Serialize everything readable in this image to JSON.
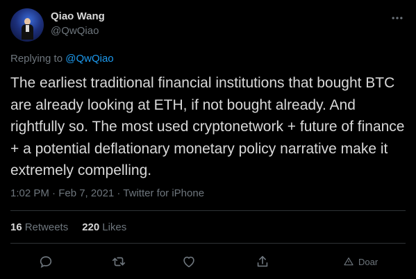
{
  "author": {
    "name": "Qiao Wang",
    "handle": "@QwQiao"
  },
  "reply": {
    "prefix": "Replying to ",
    "mention": "@QwQiao"
  },
  "tweet": {
    "text": "The earliest traditional financial institutions that bought BTC are already looking at ETH, if not bought already. And rightfully so. The most used cryptonetwork + future of finance + a potential deflationary monetary policy narrative make it extremely compelling.",
    "meta": "1:02 PM · Feb 7, 2021 · Twitter for iPhone"
  },
  "stats": {
    "retweets_count": "16",
    "retweets_label": "Retweets",
    "likes_count": "220",
    "likes_label": "Likes"
  },
  "actions": {
    "reply_icon": "comment-icon",
    "retweet_icon": "retweet-icon",
    "like_icon": "heart-icon",
    "share_icon": "share-icon",
    "extension_label": "Doar",
    "extension_icon": "triangle-icon"
  },
  "colors": {
    "background": "#000000",
    "text": "#d9d9d9",
    "secondary": "#6e767d",
    "link": "#1d9bf0",
    "divider": "#2f3336"
  }
}
